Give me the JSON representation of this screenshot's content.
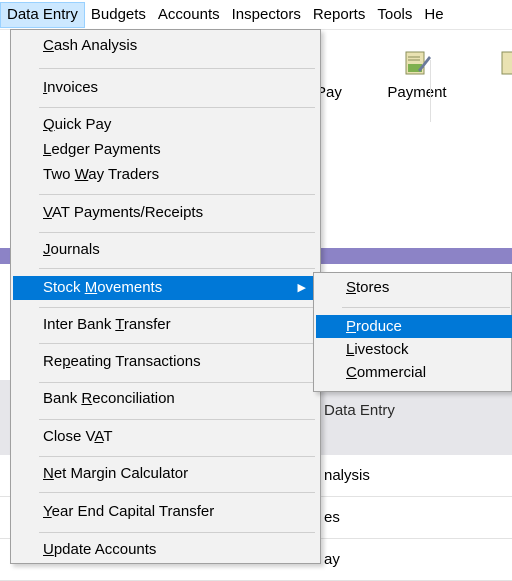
{
  "menubar": {
    "items": [
      {
        "label": "Data Entry"
      },
      {
        "label": "Budgets"
      },
      {
        "label": "Accounts"
      },
      {
        "label": "Inspectors"
      },
      {
        "label": "Reports"
      },
      {
        "label": "Tools"
      },
      {
        "label": "He"
      }
    ]
  },
  "toolbar": {
    "pay_label": "Pay",
    "payment_label": "Payment"
  },
  "background": {
    "panel_title": "Data Entry",
    "rows": [
      "nalysis",
      "es",
      "ay"
    ]
  },
  "data_entry_menu": {
    "items": [
      {
        "pre": "",
        "key": "C",
        "post": "ash Analysis"
      },
      {
        "pre": "",
        "key": "I",
        "post": "nvoices"
      },
      {
        "pre": "",
        "key": "Q",
        "post": "uick Pay"
      },
      {
        "pre": "",
        "key": "L",
        "post": "edger Payments"
      },
      {
        "pre": "Two ",
        "key": "W",
        "post": "ay Traders"
      },
      {
        "pre": "",
        "key": "V",
        "post": "AT Payments/Receipts"
      },
      {
        "pre": "",
        "key": "J",
        "post": "ournals"
      },
      {
        "pre": "Stock ",
        "key": "M",
        "post": "ovements"
      },
      {
        "pre": "Inter Bank ",
        "key": "T",
        "post": "ransfer"
      },
      {
        "pre": "Re",
        "key": "p",
        "post": "eating Transactions"
      },
      {
        "pre": "Bank ",
        "key": "R",
        "post": "econciliation"
      },
      {
        "pre": "Close V",
        "key": "A",
        "post": "T"
      },
      {
        "pre": "",
        "key": "N",
        "post": "et Margin Calculator"
      },
      {
        "pre": "",
        "key": "Y",
        "post": "ear End Capital Transfer"
      },
      {
        "pre": "",
        "key": "U",
        "post": "pdate Accounts"
      }
    ],
    "submenu_arrow": "▶"
  },
  "stock_movements_submenu": {
    "items": [
      {
        "pre": "",
        "key": "S",
        "post": "tores"
      },
      {
        "pre": "",
        "key": "P",
        "post": "roduce"
      },
      {
        "pre": "",
        "key": "L",
        "post": "ivestock"
      },
      {
        "pre": "",
        "key": "C",
        "post": "ommercial"
      }
    ]
  },
  "colors": {
    "highlight": "#0078d7",
    "menu_bg": "#f2f2f2",
    "active_menubar_bg": "#cce8ff",
    "band": "#8c83c6"
  }
}
